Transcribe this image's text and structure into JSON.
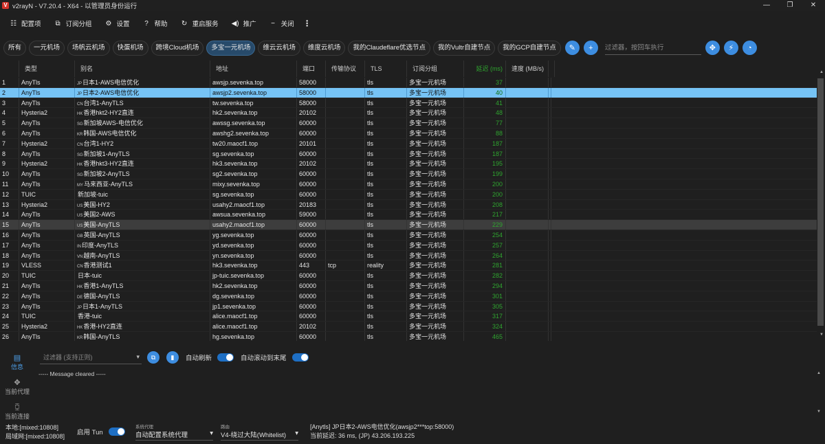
{
  "window": {
    "title": "v2rayN - V7.20.4 - X64 - 以管理员身份运行",
    "logo": "V"
  },
  "menu": [
    {
      "icon": "☷",
      "icon_name": "config-icon",
      "label": "配置项"
    },
    {
      "icon": "⧉",
      "icon_name": "subscription-icon",
      "label": "订阅分组"
    },
    {
      "icon": "⚙",
      "icon_name": "gear-icon",
      "label": "设置"
    },
    {
      "icon": "?",
      "icon_name": "help-icon",
      "label": "帮助"
    },
    {
      "icon": "↻",
      "icon_name": "restart-icon",
      "label": "重启服务"
    },
    {
      "icon": "◀)",
      "icon_name": "promote-icon",
      "label": "推广"
    },
    {
      "icon": "−",
      "icon_name": "close-icon",
      "label": "关闭"
    }
  ],
  "tabs": [
    "所有",
    "一元机场",
    "场帆云机场",
    "快蛋机场",
    "跨境Cloud机场",
    "多宝一元机场",
    "维云云机场",
    "维度云机场",
    "我的Claudeflare优选节点",
    "我的Vultr自建节点",
    "我的GCP自建节点"
  ],
  "active_tab": 5,
  "filter_placeholder": "过滤器，按回车执行",
  "columns": [
    "",
    "类型",
    "别名",
    "地址",
    "端口",
    "传输协议",
    "TLS",
    "订阅分组",
    "延迟 (ms)",
    "速度 (MB/s)"
  ],
  "rows": [
    {
      "n": "1",
      "type": "AnyTls",
      "flag": "JP",
      "name": "日本1-AWS电信优化",
      "addr": "awsjp.sevenka.top",
      "port": "58000",
      "net": "",
      "tls": "tls",
      "group": "多宝一元机场",
      "delay": "37"
    },
    {
      "n": "2",
      "type": "AnyTls",
      "flag": "JP",
      "name": "日本2-AWS电信优化",
      "addr": "awsjp2.sevenka.top",
      "port": "58000",
      "net": "",
      "tls": "tls",
      "group": "多宝一元机场",
      "delay": "40"
    },
    {
      "n": "3",
      "type": "AnyTls",
      "flag": "CN",
      "name": "台湾1-AnyTLS",
      "addr": "tw.sevenka.top",
      "port": "58000",
      "net": "",
      "tls": "tls",
      "group": "多宝一元机场",
      "delay": "41"
    },
    {
      "n": "4",
      "type": "Hysteria2",
      "flag": "HK",
      "name": "香港hkt2-HY2直连",
      "addr": "hk2.sevenka.top",
      "port": "20102",
      "net": "",
      "tls": "tls",
      "group": "多宝一元机场",
      "delay": "48"
    },
    {
      "n": "5",
      "type": "AnyTls",
      "flag": "SG",
      "name": "新加坡AWS-电信优化",
      "addr": "awssg.sevenka.top",
      "port": "60000",
      "net": "",
      "tls": "tls",
      "group": "多宝一元机场",
      "delay": "77"
    },
    {
      "n": "6",
      "type": "AnyTls",
      "flag": "KR",
      "name": "韩国-AWS电信优化",
      "addr": "awshg2.sevenka.top",
      "port": "60000",
      "net": "",
      "tls": "tls",
      "group": "多宝一元机场",
      "delay": "88"
    },
    {
      "n": "7",
      "type": "Hysteria2",
      "flag": "CN",
      "name": "台湾1-HY2",
      "addr": "tw20.maocf1.top",
      "port": "20101",
      "net": "",
      "tls": "tls",
      "group": "多宝一元机场",
      "delay": "187"
    },
    {
      "n": "8",
      "type": "AnyTls",
      "flag": "SG",
      "name": "新加坡1-AnyTLS",
      "addr": "sg.sevenka.top",
      "port": "60000",
      "net": "",
      "tls": "tls",
      "group": "多宝一元机场",
      "delay": "187"
    },
    {
      "n": "9",
      "type": "Hysteria2",
      "flag": "HK",
      "name": "香港hkt3-HY2直连",
      "addr": "hk3.sevenka.top",
      "port": "20102",
      "net": "",
      "tls": "tls",
      "group": "多宝一元机场",
      "delay": "195"
    },
    {
      "n": "10",
      "type": "AnyTls",
      "flag": "SG",
      "name": "新加坡2-AnyTLS",
      "addr": "sg2.sevenka.top",
      "port": "60000",
      "net": "",
      "tls": "tls",
      "group": "多宝一元机场",
      "delay": "199"
    },
    {
      "n": "11",
      "type": "AnyTls",
      "flag": "MY",
      "name": "马来西亚-AnyTLS",
      "addr": "mixy.sevenka.top",
      "port": "60000",
      "net": "",
      "tls": "tls",
      "group": "多宝一元机场",
      "delay": "200"
    },
    {
      "n": "12",
      "type": "TUIC",
      "flag": "",
      "name": "新加坡-tuic",
      "addr": "sg.sevenka.top",
      "port": "60000",
      "net": "",
      "tls": "tls",
      "group": "多宝一元机场",
      "delay": "200"
    },
    {
      "n": "13",
      "type": "Hysteria2",
      "flag": "US",
      "name": "美国-HY2",
      "addr": "usahy2.maocf1.top",
      "port": "20183",
      "net": "",
      "tls": "tls",
      "group": "多宝一元机场",
      "delay": "208"
    },
    {
      "n": "14",
      "type": "AnyTls",
      "flag": "US",
      "name": "美国2-AWS",
      "addr": "awsua.sevenka.top",
      "port": "59000",
      "net": "",
      "tls": "tls",
      "group": "多宝一元机场",
      "delay": "217"
    },
    {
      "n": "15",
      "type": "AnyTls",
      "flag": "US",
      "name": "美国-AnyTLS",
      "addr": "usahy2.maocf1.top",
      "port": "60000",
      "net": "",
      "tls": "tls",
      "group": "多宝一元机场",
      "delay": "229"
    },
    {
      "n": "16",
      "type": "AnyTls",
      "flag": "GB",
      "name": "英国-AnyTLS",
      "addr": "yg.sevenka.top",
      "port": "60000",
      "net": "",
      "tls": "tls",
      "group": "多宝一元机场",
      "delay": "254"
    },
    {
      "n": "17",
      "type": "AnyTls",
      "flag": "IN",
      "name": "印度-AnyTLS",
      "addr": "yd.sevenka.top",
      "port": "60000",
      "net": "",
      "tls": "tls",
      "group": "多宝一元机场",
      "delay": "257"
    },
    {
      "n": "18",
      "type": "AnyTls",
      "flag": "VN",
      "name": "越南-AnyTLS",
      "addr": "yn.sevenka.top",
      "port": "60000",
      "net": "",
      "tls": "tls",
      "group": "多宝一元机场",
      "delay": "264"
    },
    {
      "n": "19",
      "type": "VLESS",
      "flag": "CN",
      "name": "香港测试1",
      "addr": "hk3.sevenka.top",
      "port": "443",
      "net": "tcp",
      "tls": "reality",
      "group": "多宝一元机场",
      "delay": "281"
    },
    {
      "n": "20",
      "type": "TUIC",
      "flag": "",
      "name": "日本-tuic",
      "addr": "jp-tuic.sevenka.top",
      "port": "60000",
      "net": "",
      "tls": "tls",
      "group": "多宝一元机场",
      "delay": "282"
    },
    {
      "n": "21",
      "type": "AnyTls",
      "flag": "HK",
      "name": "香港1-AnyTLS",
      "addr": "hk2.sevenka.top",
      "port": "60000",
      "net": "",
      "tls": "tls",
      "group": "多宝一元机场",
      "delay": "294"
    },
    {
      "n": "22",
      "type": "AnyTls",
      "flag": "DE",
      "name": "德国-AnyTLS",
      "addr": "dg.sevenka.top",
      "port": "60000",
      "net": "",
      "tls": "tls",
      "group": "多宝一元机场",
      "delay": "301"
    },
    {
      "n": "23",
      "type": "AnyTls",
      "flag": "JP",
      "name": "日本1-AnyTLS",
      "addr": "jp1.sevenka.top",
      "port": "60000",
      "net": "",
      "tls": "tls",
      "group": "多宝一元机场",
      "delay": "305"
    },
    {
      "n": "24",
      "type": "TUIC",
      "flag": "",
      "name": "香港-tuic",
      "addr": "alice.maocf1.top",
      "port": "60000",
      "net": "",
      "tls": "tls",
      "group": "多宝一元机场",
      "delay": "317"
    },
    {
      "n": "25",
      "type": "Hysteria2",
      "flag": "HK",
      "name": "香港-HY2直连",
      "addr": "alice.maocf1.top",
      "port": "20102",
      "net": "",
      "tls": "tls",
      "group": "多宝一元机场",
      "delay": "324"
    },
    {
      "n": "26",
      "type": "AnyTls",
      "flag": "KR",
      "name": "韩国-AnyTLS",
      "addr": "hg.sevenka.top",
      "port": "60000",
      "net": "",
      "tls": "tls",
      "group": "多宝一元机场",
      "delay": "465"
    }
  ],
  "selected_row": 1,
  "hover_row": 14,
  "side": [
    {
      "icon": "▤",
      "icon_name": "info-icon",
      "label": "信息"
    },
    {
      "icon": "✥",
      "icon_name": "proxy-icon",
      "label": "当前代理"
    },
    {
      "icon": "⧮",
      "icon_name": "connection-icon",
      "label": "当前连接"
    }
  ],
  "log": {
    "filter_placeholder": "过滤器 (支持正则)",
    "auto_refresh": "自动刷新",
    "auto_scroll": "自动滚动到末尾",
    "message": "----- Message cleared -----"
  },
  "status": {
    "local": "本地:[mixed:10808]",
    "lan": "局域网:[mixed:10808]",
    "tun_label": "启用 Tun",
    "sysproxy_caption": "系统代理",
    "sysproxy_value": "自动配置系统代理",
    "routing_caption": "路由",
    "routing_value": "V4-绕过大陆(Whitelist)",
    "current_node": "[Anytls] JP日本2-AWS电信优化(awsjp2***top:58000)",
    "latency": "当前延迟: 36 ms, (JP) 43.206.193.225"
  },
  "colors": {
    "accent": "#3d8de0",
    "selected_row": "#76c3f5",
    "delay_text": "#2fa52f",
    "logo": "#d3332b"
  }
}
